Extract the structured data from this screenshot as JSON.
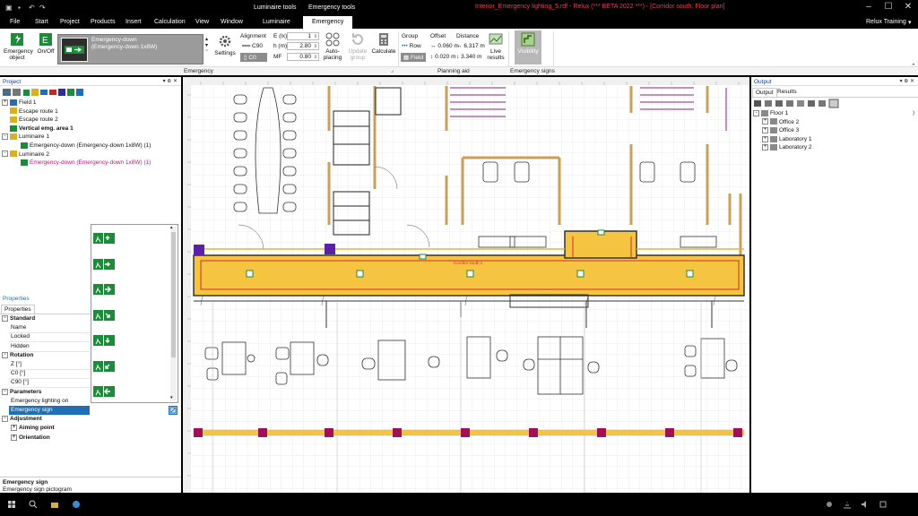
{
  "titlebar": {
    "title": "Interior_Emergency lighting_5.rdf - Relux (*** BETA 2022 ***) - [Corridor south: Floor plan]",
    "context_tabs": [
      "Luminaire tools",
      "Emergency tools"
    ]
  },
  "menu": {
    "items": [
      "File",
      "Start",
      "Project",
      "Products",
      "Insert",
      "Calculation",
      "View",
      "Window",
      "Luminaire",
      "Emergency"
    ],
    "active": "Emergency",
    "user": "Relux Training"
  },
  "ribbon": {
    "emergency_object": "Emergency object",
    "onoff": "On/Off",
    "luminaire_name": "Emergency-down",
    "luminaire_model": "(Emergency-down 1x8W)",
    "settings": "Settings",
    "alignment_label": "Alignment",
    "c90": "C90",
    "c0": "C0",
    "e_label": "E (lx)",
    "e_value": "1",
    "h_label": "h (m)",
    "h_value": "2.80",
    "mf_label": "MF",
    "mf_value": "0.80",
    "auto_placing": "Auto-placing",
    "update_group": "Update group",
    "calculate": "Calculate",
    "group_label": "Group",
    "row_label": "Row",
    "field_label": "Field",
    "offset_label": "Offset",
    "distance_label": "Distance",
    "offset_row": "0.060 m",
    "offset_field": "0.020 m",
    "distance_row": "6.317 m",
    "distance_field": "3.340 m",
    "live_results": "Live results",
    "visibility": "Visibility",
    "groups": [
      "Emergency",
      "Planning aid",
      "Emergency signs"
    ]
  },
  "project_panel": {
    "title": "Project",
    "tree": [
      {
        "label": "Field 1",
        "level": 0,
        "bold": false,
        "pink": false,
        "expander": "+"
      },
      {
        "label": "Escape route 1",
        "level": 0,
        "bold": false,
        "pink": false,
        "expander": ""
      },
      {
        "label": "Escape route 2",
        "level": 0,
        "bold": false,
        "pink": false,
        "expander": ""
      },
      {
        "label": "Vertical emg. area 1",
        "level": 0,
        "bold": true,
        "pink": false,
        "expander": ""
      },
      {
        "label": "Luminaire  1",
        "level": 0,
        "bold": false,
        "pink": false,
        "expander": "-"
      },
      {
        "label": "Emergency-down (Emergency-down 1x8W) (1)",
        "level": 1,
        "bold": false,
        "pink": false,
        "expander": ""
      },
      {
        "label": "Luminaire  2",
        "level": 0,
        "bold": false,
        "pink": false,
        "expander": "-"
      },
      {
        "label": "Emergency-down (Emergency-down 1x8W) (1)",
        "level": 1,
        "bold": false,
        "pink": true,
        "expander": ""
      }
    ]
  },
  "properties": {
    "title": "Properties",
    "tab": "Properties",
    "sections": [
      {
        "name": "Standard",
        "rows": [
          "Name",
          "Locked",
          "Hidden"
        ]
      },
      {
        "name": "Rotation",
        "rows": [
          "Z [°]",
          "C0 [°]",
          "C90 [°]"
        ]
      },
      {
        "name": "Parameters",
        "rows": [
          "Emergency lighting on",
          "Emergency sign"
        ]
      },
      {
        "name": "Adjustment",
        "rows": []
      }
    ],
    "sub_items": [
      "Aiming point",
      "Orientation"
    ],
    "selected_row": "Emergency sign",
    "help_title": "Emergency sign",
    "help_text": "Emergency sign pictogram"
  },
  "output_panel": {
    "title": "Output",
    "tabs": [
      "Output",
      "Results"
    ],
    "tree": [
      {
        "label": "Floor 1",
        "level": 0
      },
      {
        "label": "Office 2",
        "level": 1
      },
      {
        "label": "Office 3",
        "level": 1
      },
      {
        "label": "Laboratory 1",
        "level": 1
      },
      {
        "label": "Laboratory 2",
        "level": 1
      }
    ]
  },
  "canvas": {
    "corridor_label": "Corridor south 1",
    "accent": "#f5c542",
    "highlight": "#d22a2a"
  }
}
